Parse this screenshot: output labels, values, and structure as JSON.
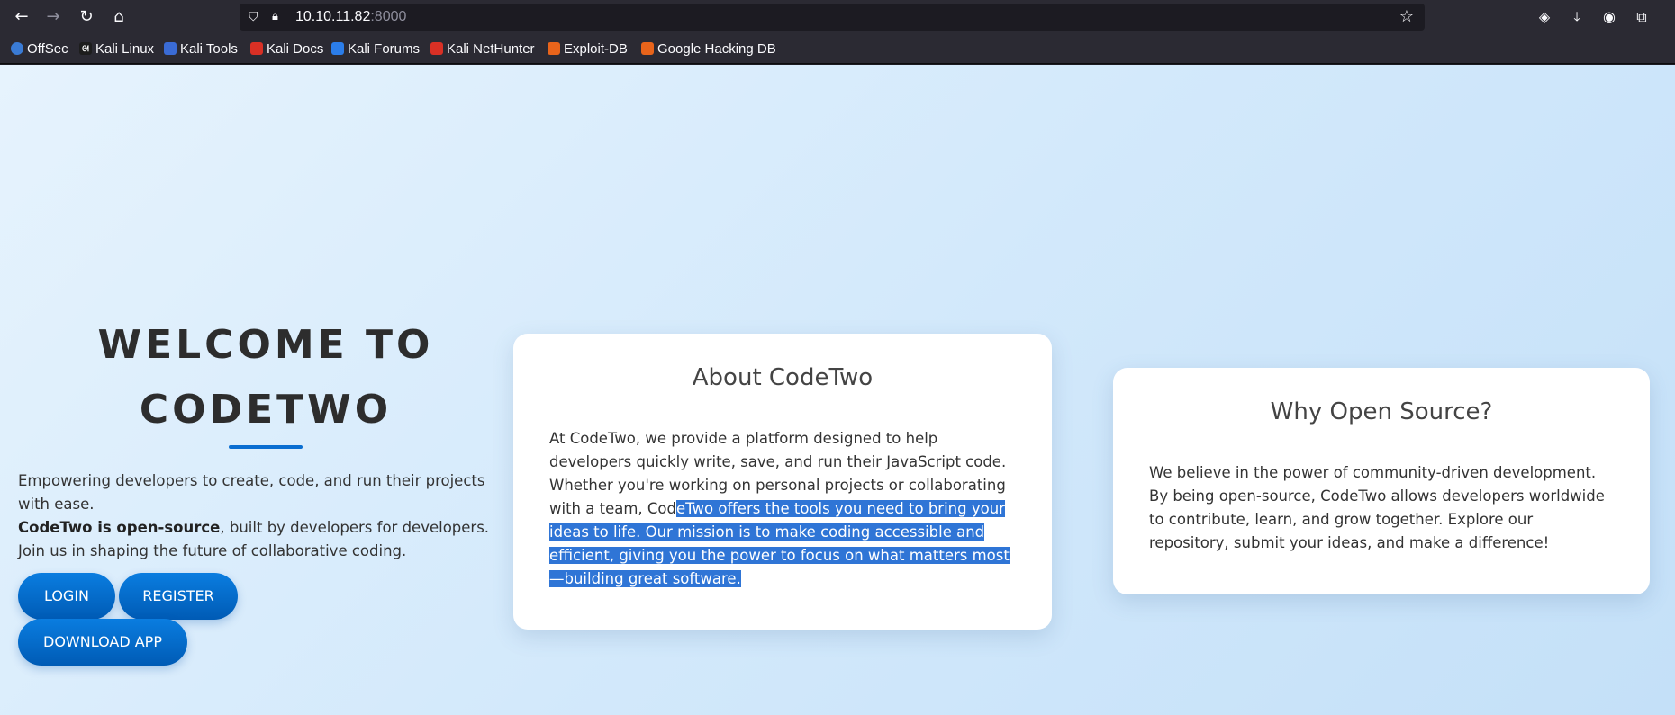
{
  "browser": {
    "url_host": "10.10.11.82",
    "url_port": ":8000"
  },
  "bookmarks": [
    {
      "label": "OffSec",
      "color": "#3a7bd5"
    },
    {
      "label": "Kali Linux",
      "color": "#1d1d1d"
    },
    {
      "label": "Kali Tools",
      "color": "#3a6bd5"
    },
    {
      "label": "Kali Docs",
      "color": "#d93025"
    },
    {
      "label": "Kali Forums",
      "color": "#2b7de9"
    },
    {
      "label": "Kali NetHunter",
      "color": "#d93025"
    },
    {
      "label": "Exploit-DB",
      "color": "#e8641b"
    },
    {
      "label": "Google Hacking DB",
      "color": "#e8641b"
    }
  ],
  "hero": {
    "title_line1": "WELCOME TO",
    "title_line2": "CODETWO",
    "line1": "Empowering developers to create, code, and run their projects with ease.",
    "bold": "CodeTwo is open-source",
    "line2": ", built by developers for developers. Join us in shaping the future of collaborative coding."
  },
  "buttons": {
    "login": "LOGIN",
    "register": "REGISTER",
    "download": "DOWNLOAD APP"
  },
  "about": {
    "title": "About CodeTwo",
    "text_before": "At CodeTwo, we provide a platform designed to help developers quickly write, save, and run their JavaScript code. Whether you're working on personal projects or collaborating with a team, Cod",
    "text_selected": "eTwo offers the tools you need to bring your ideas to life. Our mission is to make coding accessible and efficient, giving you the power to focus on what matters most—building great software."
  },
  "why": {
    "title": "Why Open Source?",
    "text": "We believe in the power of community-driven development. By being open-source, CodeTwo allows developers worldwide to contribute, learn, and grow together. Explore our repository, submit your ideas, and make a difference!"
  },
  "colors": {
    "accent": "#0a6ed1",
    "selection": "#2f75d6"
  }
}
